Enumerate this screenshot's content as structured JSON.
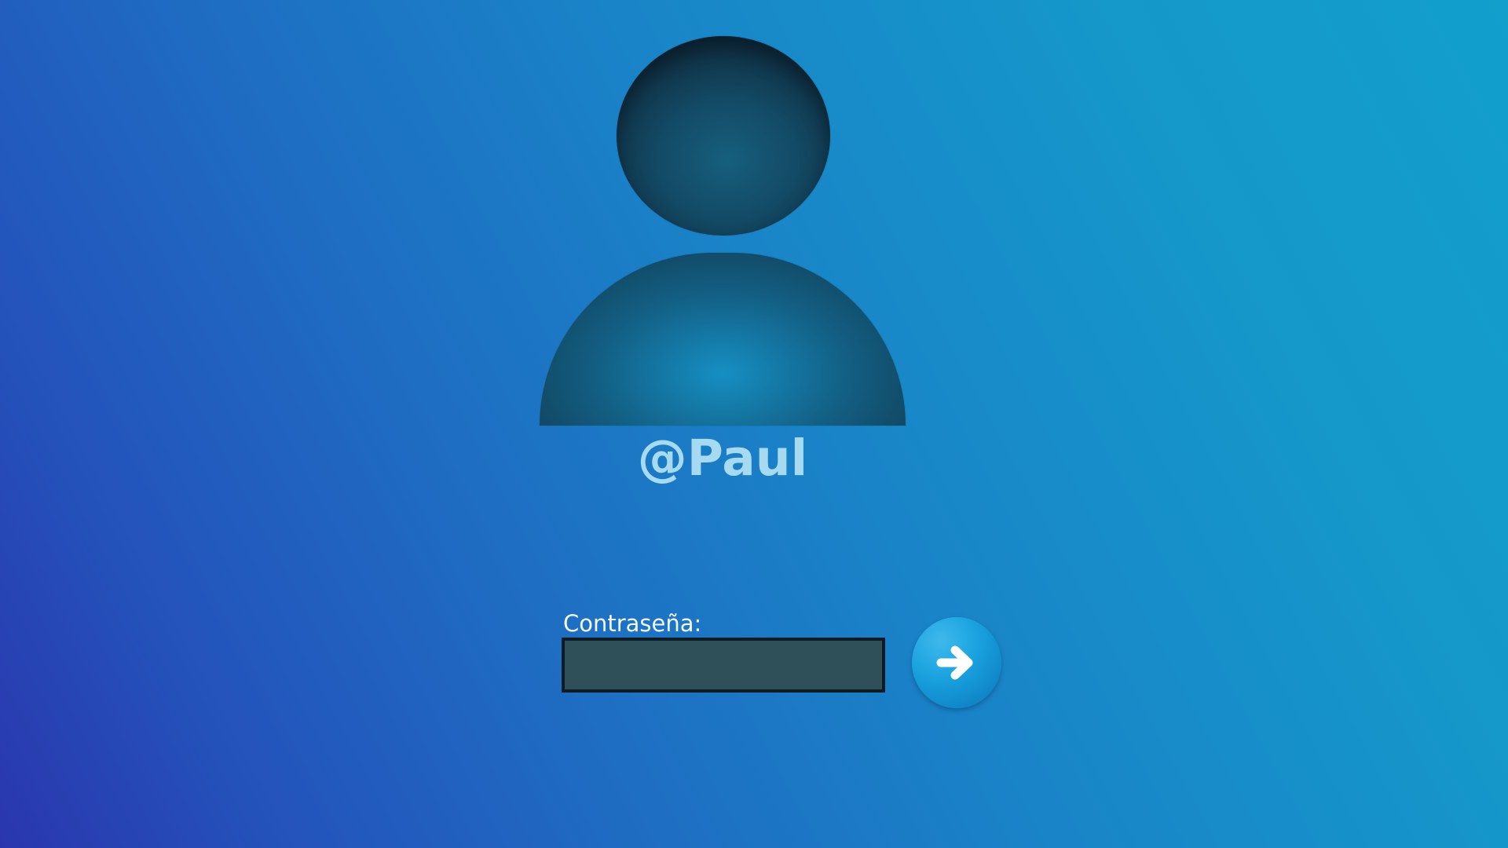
{
  "screen": {
    "background_start": "#2a36ae",
    "background_end": "#129fcc"
  },
  "user": {
    "avatar_icon": "user-silhouette-icon",
    "username": "@Paul"
  },
  "password": {
    "label": "Contraseña:",
    "value": "",
    "placeholder": ""
  },
  "submit": {
    "icon": "arrow-right-icon",
    "color": "#1aa3df"
  }
}
